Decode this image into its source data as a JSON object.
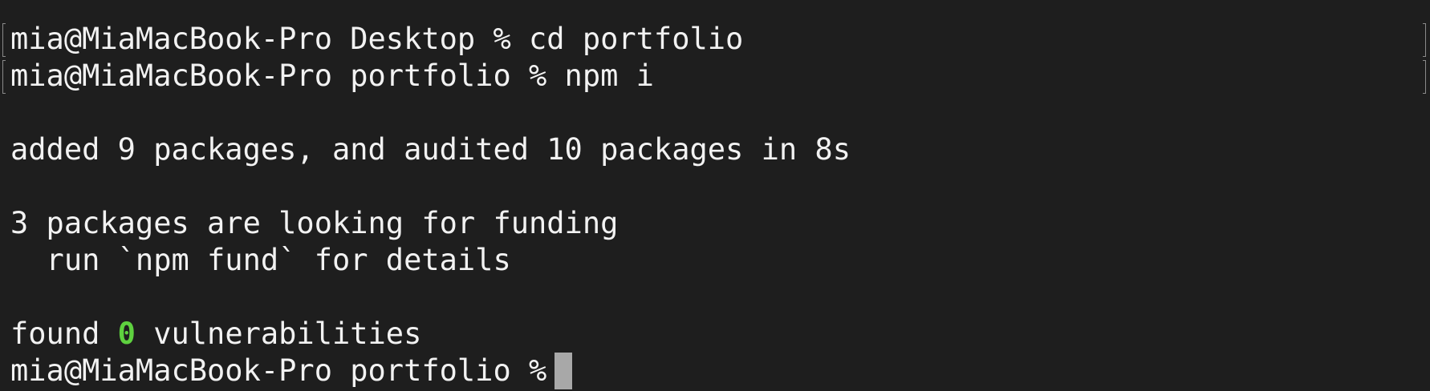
{
  "terminal": {
    "line1": "mia@MiaMacBook-Pro Desktop % cd portfolio",
    "line2": "mia@MiaMacBook-Pro portfolio % npm i",
    "line3": "added 9 packages, and audited 10 packages in 8s",
    "line4": "3 packages are looking for funding",
    "line5": "  run `npm fund` for details",
    "found_prefix": "found ",
    "vuln_count": "0",
    "found_suffix": " vulnerabilities",
    "prompt": "mia@MiaMacBook-Pro portfolio %"
  },
  "colors": {
    "background": "#1e1e1e",
    "text": "#f2f2f2",
    "highlight": "#5ed13f",
    "cursor": "#a8a8a8"
  }
}
